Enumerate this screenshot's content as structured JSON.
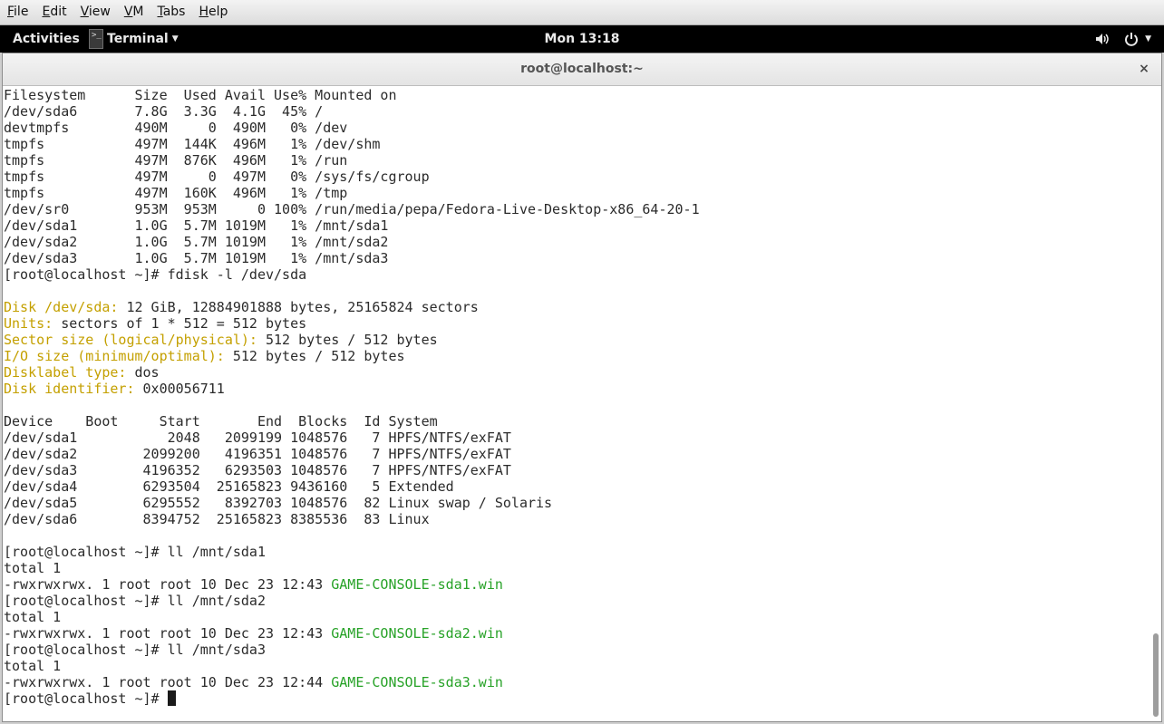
{
  "vm_menubar": {
    "items": [
      {
        "accel": "F",
        "rest": "ile"
      },
      {
        "accel": "E",
        "rest": "dit"
      },
      {
        "accel": "V",
        "rest": "iew"
      },
      {
        "accel": "V",
        "rest": "M"
      },
      {
        "accel": "T",
        "rest": "abs"
      },
      {
        "accel": "H",
        "rest": "elp"
      }
    ]
  },
  "topbar": {
    "activities": "Activities",
    "app_name": "Terminal",
    "app_icon_glyph": ">_",
    "clock": "Mon 13:18",
    "icons": [
      "volume-icon",
      "power-icon",
      "chevron-down-icon"
    ]
  },
  "window": {
    "title": "root@localhost:~",
    "close_glyph": "×"
  },
  "terminal": {
    "lines": [
      [
        {
          "t": "Filesystem      Size  Used Avail Use% Mounted on"
        }
      ],
      [
        {
          "t": "/dev/sda6       7.8G  3.3G  4.1G  45% /"
        }
      ],
      [
        {
          "t": "devtmpfs        490M     0  490M   0% /dev"
        }
      ],
      [
        {
          "t": "tmpfs           497M  144K  496M   1% /dev/shm"
        }
      ],
      [
        {
          "t": "tmpfs           497M  876K  496M   1% /run"
        }
      ],
      [
        {
          "t": "tmpfs           497M     0  497M   0% /sys/fs/cgroup"
        }
      ],
      [
        {
          "t": "tmpfs           497M  160K  496M   1% /tmp"
        }
      ],
      [
        {
          "t": "/dev/sr0        953M  953M     0 100% /run/media/pepa/Fedora-Live-Desktop-x86_64-20-1"
        }
      ],
      [
        {
          "t": "/dev/sda1       1.0G  5.7M 1019M   1% /mnt/sda1"
        }
      ],
      [
        {
          "t": "/dev/sda2       1.0G  5.7M 1019M   1% /mnt/sda2"
        }
      ],
      [
        {
          "t": "/dev/sda3       1.0G  5.7M 1019M   1% /mnt/sda3"
        }
      ],
      [
        {
          "t": "[root@localhost ~]# fdisk -l /dev/sda"
        }
      ],
      [
        {
          "t": ""
        }
      ],
      [
        {
          "t": "Disk /dev/sda:",
          "c": "label"
        },
        {
          "t": " 12 GiB, 12884901888 bytes, 25165824 sectors"
        }
      ],
      [
        {
          "t": "Units:",
          "c": "label"
        },
        {
          "t": " sectors of 1 * 512 = 512 bytes"
        }
      ],
      [
        {
          "t": "Sector size (logical/physical):",
          "c": "label"
        },
        {
          "t": " 512 bytes / 512 bytes"
        }
      ],
      [
        {
          "t": "I/O size (minimum/optimal):",
          "c": "label"
        },
        {
          "t": " 512 bytes / 512 bytes"
        }
      ],
      [
        {
          "t": "Disklabel type:",
          "c": "label"
        },
        {
          "t": " dos"
        }
      ],
      [
        {
          "t": "Disk identifier:",
          "c": "label"
        },
        {
          "t": " 0x00056711"
        }
      ],
      [
        {
          "t": ""
        }
      ],
      [
        {
          "t": "Device    Boot     Start       End  Blocks  Id System"
        }
      ],
      [
        {
          "t": "/dev/sda1           2048   2099199 1048576   7 HPFS/NTFS/exFAT"
        }
      ],
      [
        {
          "t": "/dev/sda2        2099200   4196351 1048576   7 HPFS/NTFS/exFAT"
        }
      ],
      [
        {
          "t": "/dev/sda3        4196352   6293503 1048576   7 HPFS/NTFS/exFAT"
        }
      ],
      [
        {
          "t": "/dev/sda4        6293504  25165823 9436160   5 Extended"
        }
      ],
      [
        {
          "t": "/dev/sda5        6295552   8392703 1048576  82 Linux swap / Solaris"
        }
      ],
      [
        {
          "t": "/dev/sda6        8394752  25165823 8385536  83 Linux"
        }
      ],
      [
        {
          "t": ""
        }
      ],
      [
        {
          "t": "[root@localhost ~]# ll /mnt/sda1"
        }
      ],
      [
        {
          "t": "total 1"
        }
      ],
      [
        {
          "t": "-rwxrwxrwx. 1 root root 10 Dec 23 12:43 "
        },
        {
          "t": "GAME-CONSOLE-sda1.win",
          "c": "file"
        }
      ],
      [
        {
          "t": "[root@localhost ~]# ll /mnt/sda2"
        }
      ],
      [
        {
          "t": "total 1"
        }
      ],
      [
        {
          "t": "-rwxrwxrwx. 1 root root 10 Dec 23 12:43 "
        },
        {
          "t": "GAME-CONSOLE-sda2.win",
          "c": "file"
        }
      ],
      [
        {
          "t": "[root@localhost ~]# ll /mnt/sda3"
        }
      ],
      [
        {
          "t": "total 1"
        }
      ],
      [
        {
          "t": "-rwxrwxrwx. 1 root root 10 Dec 23 12:44 "
        },
        {
          "t": "GAME-CONSOLE-sda3.win",
          "c": "file"
        }
      ],
      [
        {
          "t": "[root@localhost ~]# "
        },
        {
          "cursor": true
        }
      ]
    ],
    "colors": {
      "label": "#c4a000",
      "file": "#27a227",
      "text": "#2b2b2b"
    }
  },
  "scrollbar": {
    "position_fraction": 0.87
  }
}
